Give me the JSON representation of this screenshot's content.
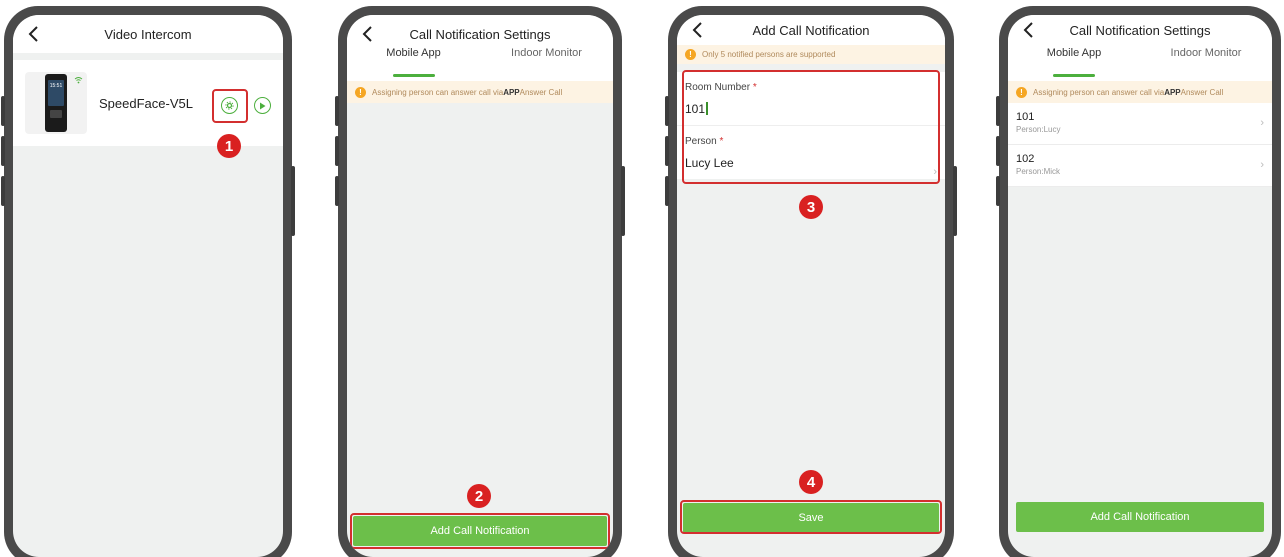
{
  "screen1": {
    "title": "Video Intercom",
    "device_name": "SpeedFace-V5L",
    "device_screen_time": "15:51",
    "marker": "1"
  },
  "screen2": {
    "title": "Call Notification Settings",
    "tabs": [
      {
        "label": "Mobile App",
        "active": true
      },
      {
        "label": "Indoor Monitor",
        "active": false
      }
    ],
    "notice_prefix": "Assigning person can answer call via",
    "notice_bold": "APP",
    "notice_suffix": "Answer Call",
    "button_label": "Add Call Notification",
    "marker": "2"
  },
  "screen3": {
    "title": "Add Call Notification",
    "notice": "Only 5 notified persons are supported",
    "room_label": "Room Number",
    "room_value": "101",
    "person_label": "Person",
    "person_value": "Lucy Lee",
    "required_mark": "*",
    "save_label": "Save",
    "marker_form": "3",
    "marker_save": "4"
  },
  "screen4": {
    "title": "Call Notification Settings",
    "tabs": [
      {
        "label": "Mobile App",
        "active": true
      },
      {
        "label": "Indoor Monitor",
        "active": false
      }
    ],
    "notice_prefix": "Assigning person can answer call via",
    "notice_bold": "APP",
    "notice_suffix": "Answer Call",
    "items": [
      {
        "room": "101",
        "person": "Person:Lucy"
      },
      {
        "room": "102",
        "person": "Person:Mick"
      }
    ],
    "button_label": "Add Call Notification"
  },
  "colors": {
    "accent_green": "#6cbf4a",
    "highlight_red": "#d32f2f",
    "marker_red": "#d92121",
    "notice_bg": "#fdf3e3",
    "warn_orange": "#f5a623"
  },
  "icons": {
    "back": "chevron-left-icon",
    "settings": "gear-icon",
    "play": "play-icon",
    "wifi": "wifi-icon",
    "warning": "warning-icon",
    "chevron": "chevron-right-icon"
  }
}
